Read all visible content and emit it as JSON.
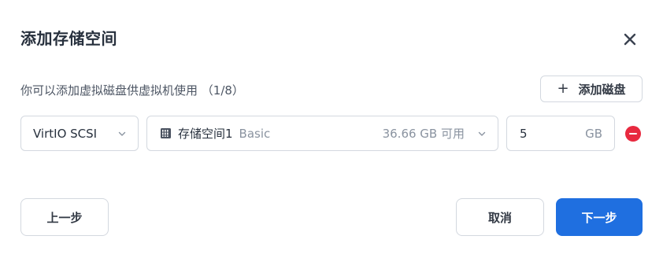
{
  "dialog": {
    "title": "添加存储空间",
    "description": "你可以添加虚拟磁盘供虚拟机使用 （1/8）",
    "add_disk_label": "添加磁盘",
    "add_disk_icon": "plus-icon",
    "close_icon": "close-icon"
  },
  "disk_row": {
    "controller": {
      "selected": "VirtIO SCSI",
      "icon": "chevron-down-icon"
    },
    "storage": {
      "icon": "storage-pool-icon",
      "name": "存储空间1",
      "type": "Basic",
      "available": "36.66 GB 可用",
      "chevron_icon": "chevron-down-icon"
    },
    "size": {
      "value": "5",
      "unit": "GB"
    },
    "remove_icon": "remove-circle-icon"
  },
  "footer": {
    "prev_label": "上一步",
    "cancel_label": "取消",
    "next_label": "下一步"
  },
  "colors": {
    "primary": "#1f6fe0",
    "danger": "#e8293f",
    "border": "#d3d8df",
    "muted_text": "#8a93a0"
  }
}
